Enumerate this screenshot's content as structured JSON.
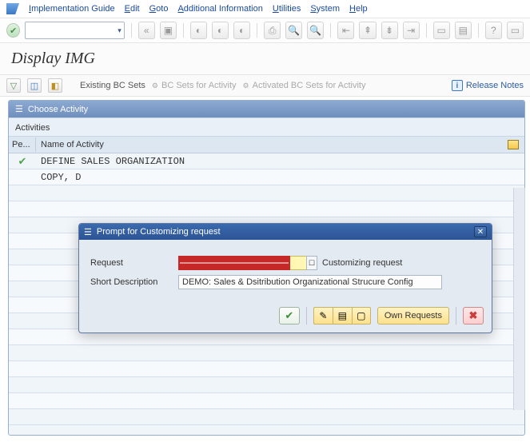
{
  "menu": {
    "items": [
      "Implementation Guide",
      "Edit",
      "Goto",
      "Additional Information",
      "Utilities",
      "System",
      "Help"
    ]
  },
  "title": "Display IMG",
  "subbar": {
    "existing": "Existing BC Sets",
    "bc_activity": "BC Sets for Activity",
    "activated": "Activated BC Sets for Activity",
    "release": "Release Notes"
  },
  "choose": {
    "title": "Choose Activity",
    "activities_lbl": "Activities",
    "col_pe": "Pe...",
    "col_name": "Name of Activity",
    "rows": [
      "DEFINE SALES ORGANIZATION",
      "COPY, D"
    ]
  },
  "dialog": {
    "title": "Prompt for Customizing request",
    "request_lbl": "Request",
    "cust_req_lbl": "Customizing request",
    "short_desc_lbl": "Short Description",
    "short_desc_val": "DEMO: Sales & Dsitribution Organizational Strucure Config",
    "own_requests": "Own Requests"
  }
}
